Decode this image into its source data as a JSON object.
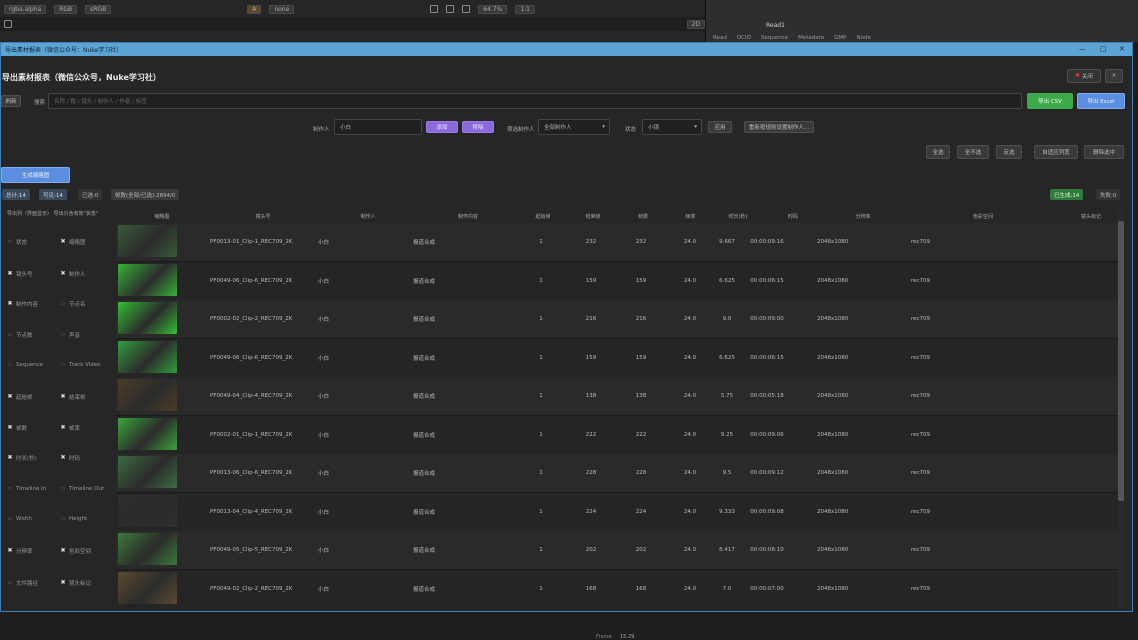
{
  "nuke": {
    "channels": "rgba.alpha",
    "colorspace_a": "RGB",
    "colorspace_b": "sRGB",
    "zoom": "64.7%",
    "ratio": "1:1",
    "view": "2D",
    "gain_a": "A",
    "gain_b": "none",
    "read_node": "Read1",
    "tabs": [
      "Read",
      "OCIO",
      "Sequence",
      "Metadata",
      "GMP",
      "Node"
    ],
    "frame_label": "Frame",
    "frame_value": "15.29"
  },
  "window": {
    "title": "导出素材报表（微信公众号：Nuke学习社）",
    "header": "导出素材报表（微信公众号，Nuke学习社）",
    "top_right_button": "关闭",
    "close_x": "✕"
  },
  "search": {
    "refresh": "刷新",
    "label": "搜索",
    "placeholder": "名称 / 路 / 镜头 / 制作人 / 作者 / 标签",
    "export_csv": "导出 CSV",
    "export_excel": "导出 Excel"
  },
  "filters": {
    "maker_label": "制作人",
    "maker_value": "小白",
    "btn_a": "添加",
    "btn_b": "移除",
    "batch_label": "筛选制作人",
    "batch_value": "全部制作人",
    "status_label": "状态",
    "status_value": "小镜",
    "apply": "应用",
    "reset": "重新按规则设置制作人..."
  },
  "actions": {
    "select_all": "全选",
    "select_none": "全不选",
    "invert": "反选",
    "fit": "自适应列宽",
    "delete": "删除选中"
  },
  "generate_thumb": "生成缩略图",
  "stats": {
    "total": "总计:14",
    "visible": "可见:14",
    "selected": "已选:0",
    "frames": "帧数(全部/已选):2894/0",
    "done": "已生成:14",
    "fail": "失败:0"
  },
  "left_panel": {
    "header": "导出列（界面显示）  导出只含有效\"状态\"",
    "items": [
      [
        "状态",
        "缩略图"
      ],
      [
        "镜头号",
        "制作人"
      ],
      [
        "制作内容",
        "节点名"
      ],
      [
        "节点数",
        "声音"
      ],
      [
        "Sequence",
        "Track Video"
      ],
      [
        "起始帧",
        "结束帧"
      ],
      [
        "帧数",
        "帧率"
      ],
      [
        "时长(秒)",
        "时码"
      ],
      [
        "Timeline In",
        "Timeline Out"
      ],
      [
        "Width",
        "Height"
      ],
      [
        "分辨率",
        "色彩空间"
      ],
      [
        "文件路径",
        "镜头标记"
      ]
    ],
    "checked": [
      [
        false,
        true
      ],
      [
        true,
        true
      ],
      [
        true,
        false
      ],
      [
        false,
        false
      ],
      [
        false,
        false
      ],
      [
        true,
        true
      ],
      [
        true,
        true
      ],
      [
        true,
        true
      ],
      [
        false,
        false
      ],
      [
        false,
        false
      ],
      [
        true,
        true
      ],
      [
        false,
        true
      ]
    ]
  },
  "columns": [
    "缩略图",
    "镜头号",
    "制作人",
    "制作内容",
    "起始帧",
    "结束帧",
    "帧数",
    "帧率",
    "时长(秒)",
    "时码",
    "分辨率",
    "色彩空间",
    "镜头标记"
  ],
  "rows": [
    [
      "PF0013-01_Clip-1_REC709_2K",
      "小白",
      "报道合成",
      "1",
      "232",
      "232",
      "24.0",
      "9.667",
      "00:00:09:16",
      "2048x1080",
      "rec709"
    ],
    [
      "PF0049-06_Clip-6_REC709_2K",
      "小白",
      "报道合成",
      "1",
      "159",
      "159",
      "24.0",
      "6.625",
      "00:00:06:15",
      "2048x1080",
      "rec709"
    ],
    [
      "PF0002-02_Clip-2_REC709_2K",
      "小白",
      "报道合成",
      "1",
      "216",
      "216",
      "24.0",
      "9.0",
      "00:00:09:00",
      "2048x1080",
      "rec709"
    ],
    [
      "PF0049-06_Clip-6_REC709_2K",
      "小白",
      "报道合成",
      "1",
      "159",
      "159",
      "24.0",
      "6.625",
      "00:00:06:15",
      "2048x1080",
      "rec709"
    ],
    [
      "PF0049-04_Clip-4_REC709_2K",
      "小白",
      "报道合成",
      "1",
      "138",
      "138",
      "24.0",
      "5.75",
      "00:00:05:18",
      "2048x1080",
      "rec709"
    ],
    [
      "PF0002-01_Clip-1_REC709_2K",
      "小白",
      "报道合成",
      "1",
      "222",
      "222",
      "24.0",
      "9.25",
      "00:00:09:06",
      "2048x1080",
      "rec709"
    ],
    [
      "PF0013-06_Clip-6_REC709_2K",
      "小白",
      "报道合成",
      "1",
      "228",
      "228",
      "24.0",
      "9.5",
      "00:00:09:12",
      "2048x1080",
      "rec709"
    ],
    [
      "PF0013-04_Clip-4_REC709_2K",
      "小白",
      "报道合成",
      "1",
      "224",
      "224",
      "24.0",
      "9.333",
      "00:00:09:08",
      "2048x1080",
      "rec709"
    ],
    [
      "PF0049-05_Clip-5_REC709_2K",
      "小白",
      "报道合成",
      "1",
      "202",
      "202",
      "24.0",
      "8.417",
      "00:00:08:10",
      "2048x1080",
      "rec709"
    ],
    [
      "PF0049-02_Clip-2_REC709_2K",
      "小白",
      "报道合成",
      "1",
      "168",
      "168",
      "24.0",
      "7.0",
      "00:00:07:00",
      "2048x1080",
      "rec709"
    ]
  ],
  "thumb_colors": [
    "#3a5a3a",
    "#35b535",
    "#32c032",
    "#2f9e3f",
    "#4a3c2a",
    "#3aa53a",
    "#3d6b44",
    "#2e2e2e",
    "#3b7a3b",
    "#5a4a32"
  ],
  "colors": {
    "accent_blue": "#5b8ee0",
    "purple": "#8a6ad8",
    "green_btn": "#3fa84a"
  }
}
